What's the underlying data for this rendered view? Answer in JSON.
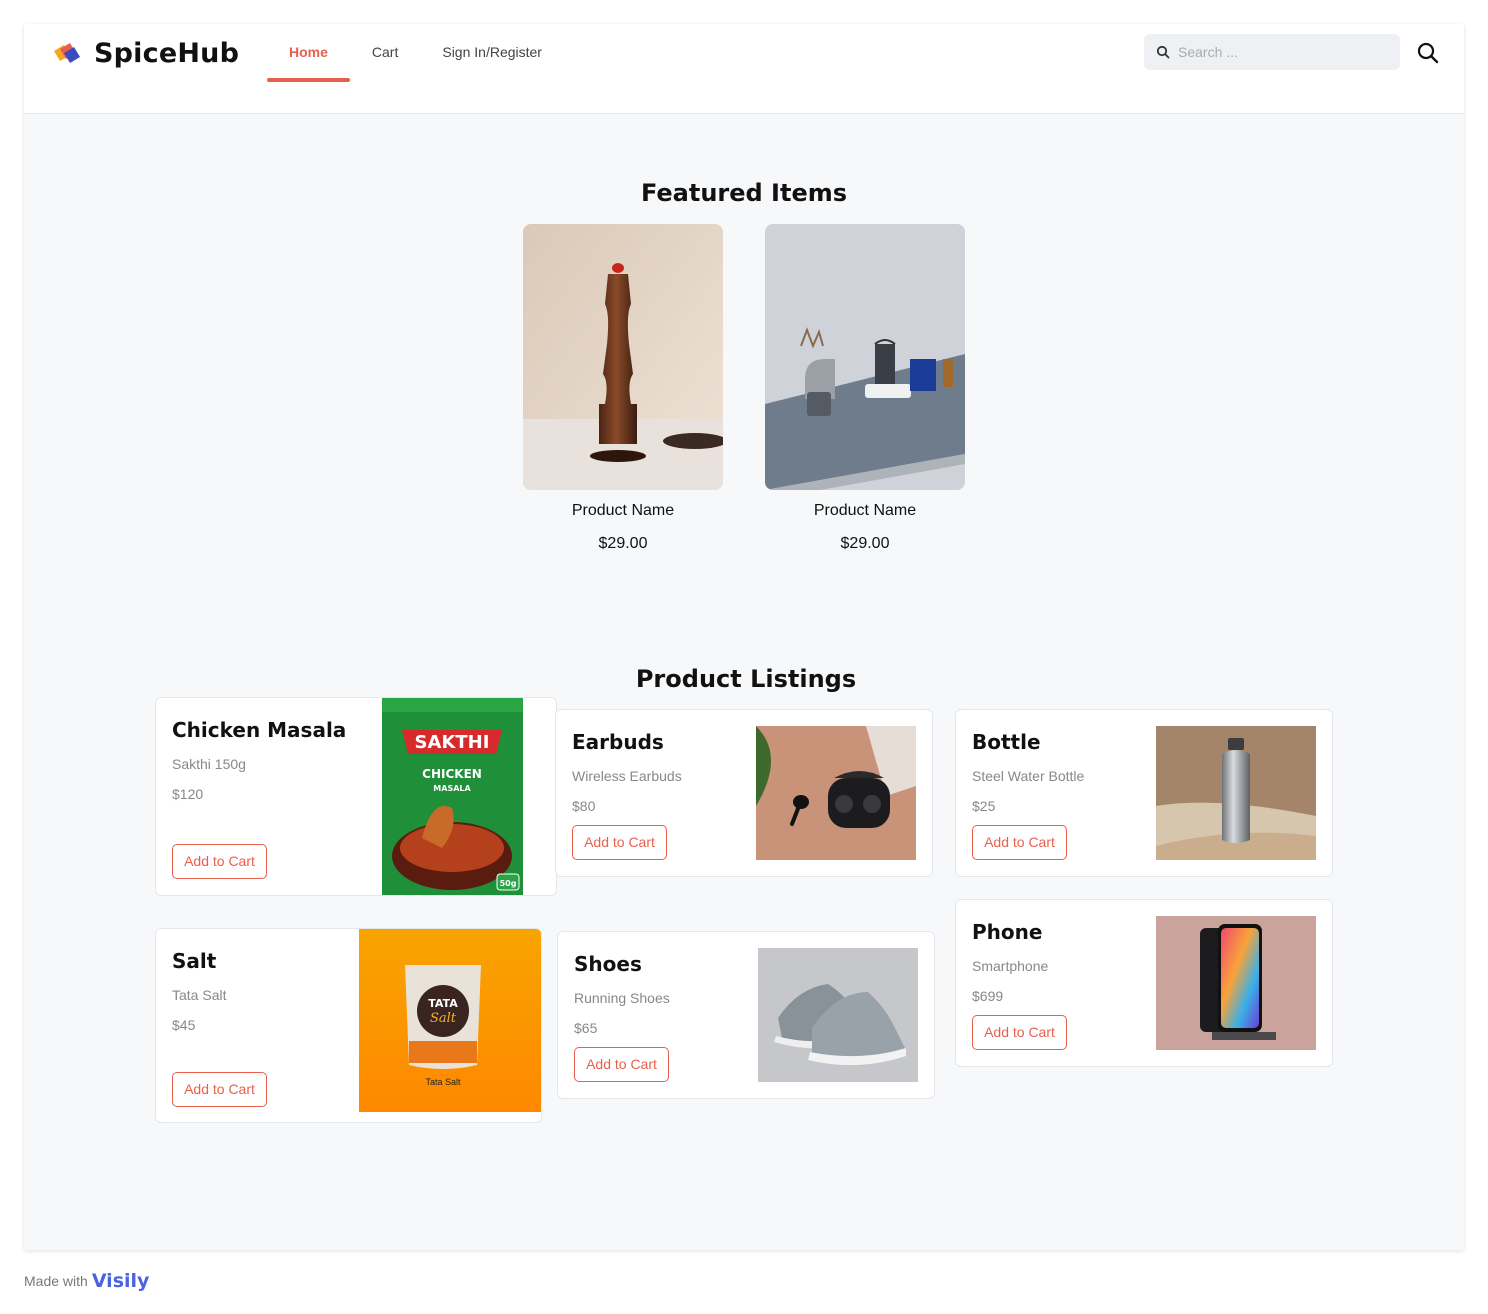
{
  "header": {
    "brand": "SpiceHub",
    "nav": [
      {
        "label": "Home",
        "active": true
      },
      {
        "label": "Cart",
        "active": false
      },
      {
        "label": "Sign In/Register",
        "active": false
      }
    ],
    "search_placeholder": "Search ..."
  },
  "featured": {
    "title": "Featured Items",
    "items": [
      {
        "name": "Product Name",
        "price": "$29.00",
        "image": "pepper-grinder"
      },
      {
        "name": "Product Name",
        "price": "$29.00",
        "image": "coffee-set"
      }
    ]
  },
  "listings": {
    "title": "Product Listings",
    "button_label": "Add to Cart",
    "products": [
      {
        "title": "Chicken Masala",
        "desc": "Sakthi 150g",
        "price": "$120",
        "image": "chicken-masala-pack",
        "pack_brand": "SAKTHI",
        "pack_line1": "CHICKEN",
        "pack_line2": "MASALA",
        "pack_weight": "50g"
      },
      {
        "title": "Earbuds",
        "desc": "Wireless Earbuds",
        "price": "$80",
        "image": "earbuds"
      },
      {
        "title": "Bottle",
        "desc": "Steel Water Bottle",
        "price": "$25",
        "image": "steel-bottle"
      },
      {
        "title": "Salt",
        "desc": "Tata Salt",
        "price": "$45",
        "image": "tata-salt-pack",
        "pack_brand": "TATA",
        "pack_script": "Salt",
        "caption": "Tata Salt"
      },
      {
        "title": "Shoes",
        "desc": "Running Shoes",
        "price": "$65",
        "image": "running-shoes"
      },
      {
        "title": "Phone",
        "desc": "Smartphone",
        "price": "$699",
        "image": "smartphone"
      }
    ]
  },
  "footer": {
    "made_with": "Made with",
    "brand": "Visily"
  },
  "colors": {
    "accent": "#e8604c",
    "page_bg": "#f7f8fa",
    "footer_brand": "#4b63e0"
  }
}
